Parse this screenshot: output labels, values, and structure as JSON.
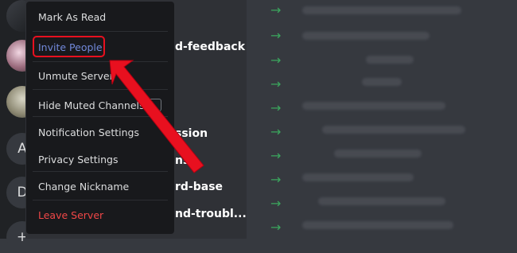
{
  "menu": {
    "items": [
      {
        "label": "Mark As Read"
      },
      {
        "label": "Invite People"
      },
      {
        "label": "Unmute Server"
      },
      {
        "label": "Hide Muted Channels"
      },
      {
        "label": "Notification Settings"
      },
      {
        "label": "Privacy Settings"
      },
      {
        "label": "Change Nickname"
      },
      {
        "label": "Leave Server"
      }
    ],
    "invite_color": "#7289da",
    "leave_color": "#f04747"
  },
  "channels": {
    "items": [
      {
        "label": "d-feedback"
      },
      {
        "label": "ssion"
      },
      {
        "label": "ns"
      },
      {
        "label": "rd-base"
      },
      {
        "label": "nd-troubl..."
      }
    ]
  },
  "servers": {
    "letters": [
      "A",
      "D",
      "+"
    ]
  },
  "colors": {
    "background": "#36393f",
    "sidebar": "#2f3136",
    "menu": "#18191c",
    "arrow": "#3ba55d",
    "annotation": "#e8101f"
  },
  "icons": {
    "row_arrow": "→"
  }
}
